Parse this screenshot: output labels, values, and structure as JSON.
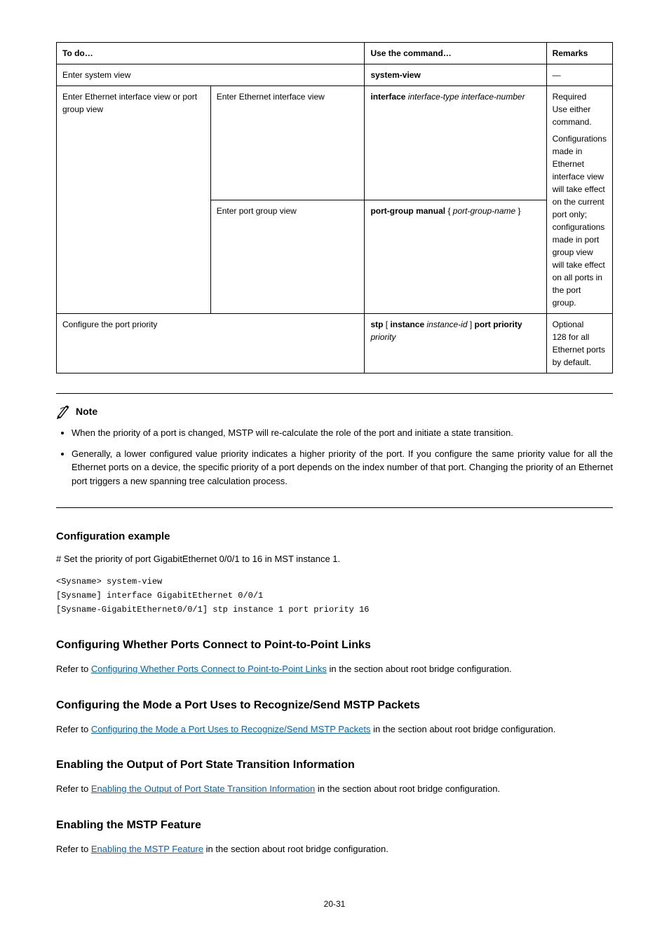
{
  "table": {
    "headers": {
      "todo": "To do…",
      "use": "Use the command…",
      "remarks": "Remarks"
    },
    "rows": {
      "sysview": {
        "label": "Enter system view",
        "cmd": "system-view",
        "remark": "—"
      },
      "ethgroup": {
        "label": "Enter Ethernet interface view or port group view"
      },
      "ethif": {
        "label": "Enter Ethernet interface view",
        "cmd_parts": {
          "cmd": "interface",
          "arg1": " interface-type",
          "arg2": "interface-number"
        }
      },
      "pgrp": {
        "label": "Enter port group view",
        "cmd_parts": {
          "cmd": "port-group manual ",
          "lbrace": "{",
          "arg": "port-group-name ",
          "rbrace": "}"
        }
      },
      "remarks_merged": {
        "l1a": "Required",
        "l1b": "Use either command.",
        "l2": "Configurations made in Ethernet interface view will take effect on the current port only; configurations made in port group view will take effect on all ports in the port group."
      },
      "prio": {
        "label": "Configure the port priority",
        "cmd_parts": {
          "cmd": "stp ",
          "lbracket": "[ ",
          "kw1": "instance ",
          "arg1": "instance-id ",
          "rbracket": "] ",
          "kw2": "port priority ",
          "arg2": "priority"
        },
        "remark_a": "Optional",
        "remark_b": "128 for all Ethernet ports by default."
      }
    }
  },
  "note": {
    "title": "Note",
    "b1": "When the priority of a port is changed, MSTP will re-calculate the role of the port and initiate a state transition.",
    "b2": "Generally, a lower configured value priority indicates a higher priority of the port. If you configure the same priority value for all the Ethernet ports on a device, the specific priority of a port depends on the index number of that port. Changing the priority of an Ethernet port triggers a new spanning tree calculation process."
  },
  "example": {
    "heading": "Configuration example",
    "intro": "# Set the priority of port GigabitEthernet 0/0/1 to 16 in MST instance 1.",
    "lines": {
      "l1": "<Sysname> system-view",
      "l2": "[Sysname] interface GigabitEthernet 0/0/1",
      "l3": "[Sysname-GigabitEthernet0/0/1] stp instance 1 port priority 16"
    }
  },
  "sections": {
    "s1": {
      "title": "Configuring Whether Ports Connect to Point-to-Point Links",
      "link": "Configuring Whether Ports Connect to Point-to-Point Links",
      "pre": "Refer to ",
      "post": " in the section about root bridge configuration."
    },
    "s2": {
      "title": "Configuring the Mode a Port Uses to Recognize/Send MSTP Packets",
      "link": "Configuring the Mode a Port Uses to Recognize/Send MSTP Packets",
      "pre": "Refer to ",
      "post": " in the section about root bridge configuration."
    },
    "s3": {
      "title": "Enabling the Output of Port State Transition Information",
      "link": "Enabling the Output of Port State Transition Information",
      "pre": "Refer to ",
      "post": " in the section about root bridge configuration."
    },
    "s4": {
      "title": "Enabling the MSTP Feature",
      "link": "Enabling the MSTP Feature",
      "pre": "Refer to ",
      "post": " in the section about root bridge configuration."
    }
  },
  "page": "20-31"
}
